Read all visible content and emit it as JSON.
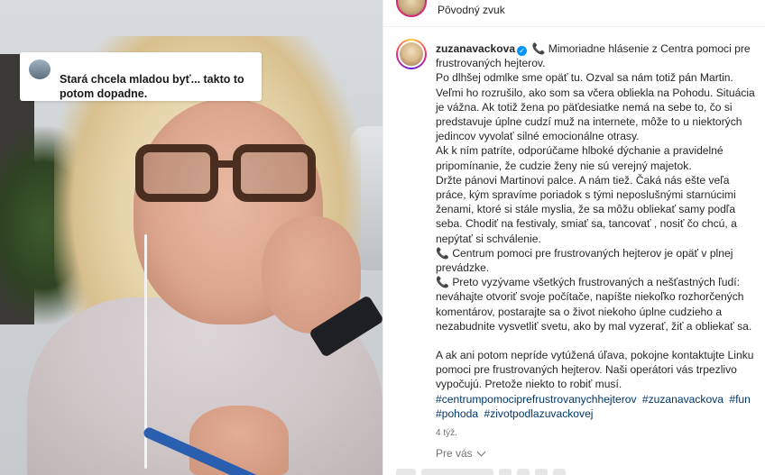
{
  "video": {
    "overlay_caption": "Stará chcela mladou byť... takto to potom dopadne.",
    "thumb_icon": "profile-thumbnail-icon"
  },
  "audio": {
    "label": "Pôvodný zvuk"
  },
  "post": {
    "username": "zuzanavackova",
    "verified_icon": "verified-badge-icon",
    "phone_icon": "telephone-receiver-emoji",
    "accent_color": "#e4405f",
    "hashtag_color": "#00376b",
    "headline": "Mimoriadne hlásenie z Centra pomoci pre frustrovaných hejterov.",
    "paragraph1": "Po dlhšej odmlke sme opäť tu. Ozval sa nám totiž pán Martin. Veľmi ho rozrušilo, ako som sa včera obliekla na Pohodu. Situácia je vážna. Ak totiž žena po päťdesiatke nemá na sebe to, čo si predstavuje úplne cudzí muž na internete, môže to u niektorých jedincov vyvolať silné emocionálne otrasy.",
    "paragraph2": "Ak k ním patríte, odporúčame hlboké dýchanie a pravidelné pripomínanie, že cudzie ženy nie sú verejný majetok.",
    "paragraph3": "Držte pánovi Martinovi palce. A nám tiež. Čaká nás ešte veľa práce, kým spravíme poriadok s tými neposlušnými starnúcimi ženami, ktoré si stále myslia, že sa môžu obliekať samy podľa seba. Chodiť na festivaly, smiať sa, tancovať , nosiť čo chcú, a nepýtať si schválenie.",
    "paragraph4": "Centrum pomoci pre frustrovaných hejterov je opäť v plnej prevádzke.",
    "paragraph5": "Preto vyzývame všetkých frustrovaných a nešťastných ľudí: neváhajte otvoriť svoje počítače, napíšte niekoľko rozhorčených komentárov, postarajte sa o život niekoho úplne cudzieho a nezabudnite vysvetliť svetu, ako by mal vyzerať, žiť a obliekať sa.",
    "paragraph6": "A ak ani potom nepríde vytúžená úľava, pokojne kontaktujte Linku pomoci pre frustrovaných hejterov. Naši operátori vás trpezlivo vypočujú. Pretože niekto to robiť musí.",
    "hashtags": [
      "#centrumpomociprefrustrovanychhejterov",
      "#zuzanavackova",
      "#fun",
      "#pohoda",
      "#zivotpodlazuvackovej"
    ],
    "time_ago": "4 týž."
  },
  "footer": {
    "for_you_label": "Pre vás",
    "chevron_icon": "chevron-down-icon"
  }
}
